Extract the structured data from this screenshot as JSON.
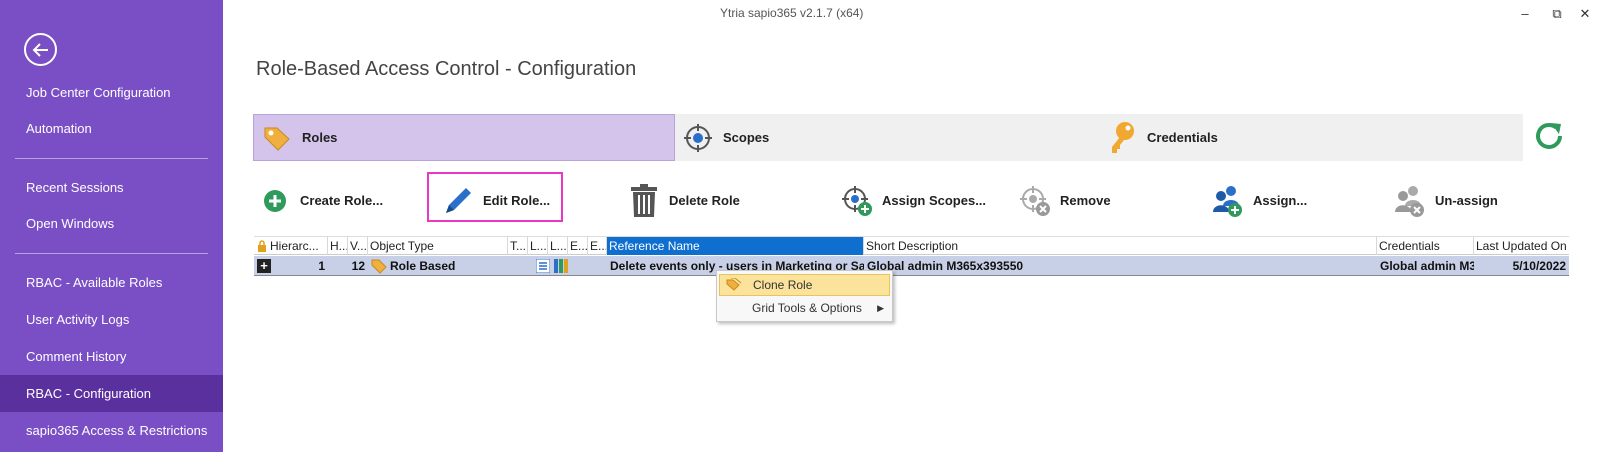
{
  "window": {
    "title": "Ytria sapio365 v2.1.7 (x64)",
    "minimize": "–",
    "restore": "⧉",
    "close": "✕"
  },
  "sidebar": {
    "items": [
      {
        "label": "Job Center Configuration"
      },
      {
        "label": "Automation"
      },
      {
        "label": "Recent Sessions"
      },
      {
        "label": "Open Windows"
      },
      {
        "label": "RBAC - Available Roles"
      },
      {
        "label": "User Activity Logs"
      },
      {
        "label": "Comment History"
      },
      {
        "label": "RBAC - Configuration",
        "active": true
      },
      {
        "label": "sapio365 Access & Restrictions"
      }
    ]
  },
  "page": {
    "title": "Role-Based Access Control - Configuration"
  },
  "tabs": [
    {
      "label": "Roles",
      "icon": "tag-icon",
      "active": true
    },
    {
      "label": "Scopes",
      "icon": "crosshair-icon"
    },
    {
      "label": "Credentials",
      "icon": "key-icon"
    }
  ],
  "toolbar": {
    "create": "Create Role...",
    "edit": "Edit Role...",
    "delete": "Delete Role",
    "assign_scopes": "Assign Scopes...",
    "remove": "Remove",
    "assign": "Assign...",
    "unassign": "Un-assign"
  },
  "grid": {
    "headers": [
      "Hierarc...",
      "H...",
      "V...",
      "Object Type",
      "T...",
      "L...",
      "L...",
      "E...",
      "E...",
      "Reference Name",
      "Short Description",
      "Credentials",
      "Last Updated On"
    ],
    "row": {
      "expander": "+",
      "hierarchy": "1",
      "v": "12",
      "object_type": "Role Based",
      "reference_name": "Delete events only - users in Marketing or Sa",
      "short_description": "Global admin M365x393550",
      "credentials": "Global admin M3",
      "last_updated": "5/10/2022"
    }
  },
  "context_menu": {
    "items": [
      {
        "label": "Clone Role",
        "icon": "clone-icon"
      },
      {
        "label": "Grid Tools & Options",
        "submenu": "▶"
      }
    ]
  },
  "colors": {
    "sidebar": "#7a4fc6",
    "sidebar_active": "#5a2f9e",
    "tab_active": "#d4c3ea",
    "highlight": "#e838c8",
    "selected_header": "#0f6fd1"
  }
}
